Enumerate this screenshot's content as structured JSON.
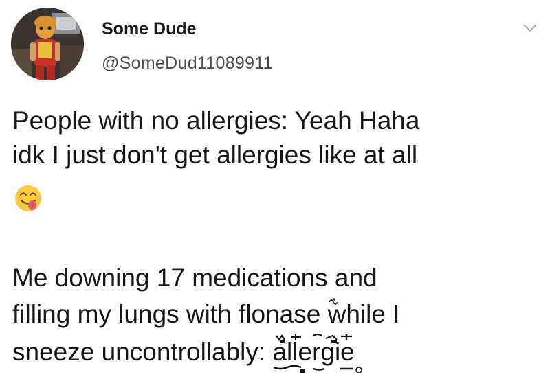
{
  "author": {
    "display_name": "Some Dude",
    "handle": "@SomeDud11089911",
    "avatar_icon": "avatar-photo",
    "menu_icon": "chevron-down-icon"
  },
  "tweet": {
    "line1": "People with no allergies: Yeah Haha",
    "line2": "idk I just don't get allergies like at all",
    "emoji": "face-savoring-food-emoji",
    "line3": "Me downing 17 medications and",
    "line4_prefix": "filling my lungs with flonase ",
    "line4_garbled": "while",
    "line4_suffix": " I",
    "line5_prefix": "sneeze uncontrollably: ",
    "line5_garbled": "allergie"
  },
  "colors": {
    "text": "#151515",
    "handle": "#4a4a4a",
    "chevron": "#b0b0b0",
    "emoji_face": "#FFC83D",
    "emoji_tongue": "#E85B6A"
  }
}
